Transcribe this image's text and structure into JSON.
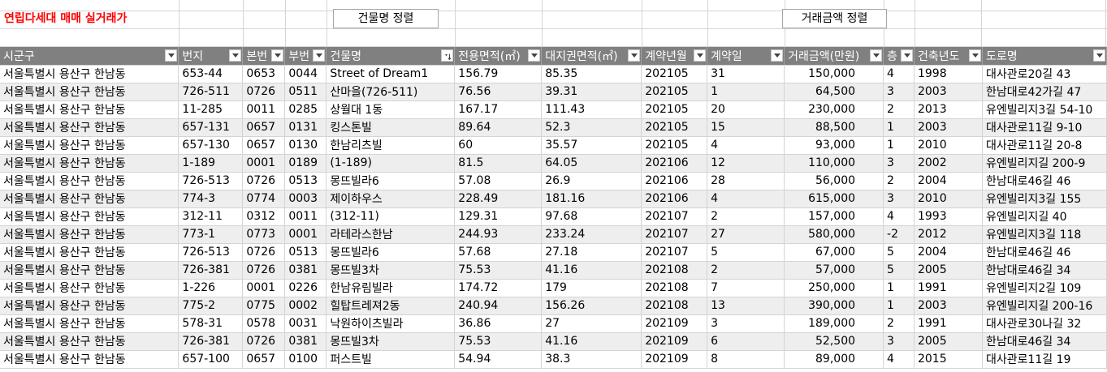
{
  "title": "연립다세대 매매 실거래가",
  "buttons": {
    "sort_by_building": "건물명 정렬",
    "sort_by_price": "거래금액 정렬"
  },
  "columns": [
    {
      "label": "시군구",
      "icon": "dropdown-arrow-icon"
    },
    {
      "label": "번지",
      "icon": "dropdown-arrow-icon"
    },
    {
      "label": "본번",
      "icon": "dropdown-arrow-icon"
    },
    {
      "label": "부번",
      "icon": "dropdown-arrow-icon"
    },
    {
      "label": "건물명",
      "icon": "sort-ascending-filter-icon"
    },
    {
      "label": "전용면적(㎡)",
      "icon": "dropdown-arrow-icon"
    },
    {
      "label": "대지권면적(㎡)",
      "icon": "dropdown-arrow-icon"
    },
    {
      "label": "계약년월",
      "icon": "dropdown-arrow-icon"
    },
    {
      "label": "계약일",
      "icon": "dropdown-arrow-icon"
    },
    {
      "label": "거래금액(만원)",
      "icon": "dropdown-arrow-icon"
    },
    {
      "label": "층",
      "icon": "dropdown-arrow-icon"
    },
    {
      "label": "건축년도",
      "icon": "dropdown-arrow-icon"
    },
    {
      "label": "도로명",
      "icon": "dropdown-arrow-icon"
    }
  ],
  "rows": [
    [
      "서울특별시 용산구 한남동",
      "653-44",
      "0653",
      "0044",
      "Street of Dream1",
      "156.79",
      "85.35",
      "202105",
      "31",
      "150,000",
      "4",
      "1998",
      "대사관로20길 43"
    ],
    [
      "서울특별시 용산구 한남동",
      "726-511",
      "0726",
      "0511",
      "산마을(726-511)",
      "76.56",
      "39.31",
      "202105",
      "1",
      "64,500",
      "3",
      "2003",
      "한남대로42가길 47"
    ],
    [
      "서울특별시 용산구 한남동",
      "11-285",
      "0011",
      "0285",
      "상월대 1동",
      "167.17",
      "111.43",
      "202105",
      "20",
      "230,000",
      "2",
      "2013",
      "유엔빌리지3길 54-10"
    ],
    [
      "서울특별시 용산구 한남동",
      "657-131",
      "0657",
      "0131",
      "킹스톤빌",
      "89.64",
      "52.3",
      "202105",
      "15",
      "88,500",
      "1",
      "2003",
      "대사관로11길 9-10"
    ],
    [
      "서울특별시 용산구 한남동",
      "657-130",
      "0657",
      "0130",
      "한남리츠빌",
      "60",
      "35.57",
      "202105",
      "4",
      "93,000",
      "1",
      "2010",
      "대사관로11길 20-8"
    ],
    [
      "서울특별시 용산구 한남동",
      "1-189",
      "0001",
      "0189",
      "(1-189)",
      "81.5",
      "64.05",
      "202106",
      "12",
      "110,000",
      "3",
      "2002",
      "유엔빌리지길 200-9"
    ],
    [
      "서울특별시 용산구 한남동",
      "726-513",
      "0726",
      "0513",
      "몽뜨빌라6",
      "57.08",
      "26.9",
      "202106",
      "28",
      "56,000",
      "2",
      "2004",
      "한남대로46길 46"
    ],
    [
      "서울특별시 용산구 한남동",
      "774-3",
      "0774",
      "0003",
      "제이하우스",
      "228.49",
      "181.16",
      "202106",
      "4",
      "615,000",
      "3",
      "2010",
      "유엔빌리지3길 155"
    ],
    [
      "서울특별시 용산구 한남동",
      "312-11",
      "0312",
      "0011",
      "(312-11)",
      "129.31",
      "97.68",
      "202107",
      "2",
      "157,000",
      "4",
      "1993",
      "유엔빌리지길 40"
    ],
    [
      "서울특별시 용산구 한남동",
      "773-1",
      "0773",
      "0001",
      "라테라스한남",
      "244.93",
      "233.24",
      "202107",
      "27",
      "580,000",
      "-2",
      "2012",
      "유엔빌리지3길 118"
    ],
    [
      "서울특별시 용산구 한남동",
      "726-513",
      "0726",
      "0513",
      "몽뜨빌라6",
      "57.68",
      "27.18",
      "202107",
      "5",
      "67,000",
      "5",
      "2004",
      "한남대로46길 46"
    ],
    [
      "서울특별시 용산구 한남동",
      "726-381",
      "0726",
      "0381",
      "몽뜨빌3차",
      "75.53",
      "41.16",
      "202108",
      "2",
      "57,000",
      "5",
      "2005",
      "한남대로46길 34"
    ],
    [
      "서울특별시 용산구 한남동",
      "1-226",
      "0001",
      "0226",
      "한남유림빌라",
      "174.72",
      "179",
      "202108",
      "7",
      "250,000",
      "1",
      "1991",
      "유엔빌리지2길 109"
    ],
    [
      "서울특별시 용산구 한남동",
      "775-2",
      "0775",
      "0002",
      "힐탑트레져2동",
      "240.94",
      "156.26",
      "202108",
      "13",
      "390,000",
      "1",
      "2003",
      "유엔빌리지길 200-16"
    ],
    [
      "서울특별시 용산구 한남동",
      "578-31",
      "0578",
      "0031",
      "낙원하이츠빌라",
      "36.86",
      "27",
      "202109",
      "3",
      "189,000",
      "2",
      "1991",
      "대사관로30나길 32"
    ],
    [
      "서울특별시 용산구 한남동",
      "726-381",
      "0726",
      "0381",
      "몽뜨빌3차",
      "75.53",
      "41.16",
      "202109",
      "6",
      "52,500",
      "3",
      "2005",
      "한남대로46길 34"
    ],
    [
      "서울특별시 용산구 한남동",
      "657-100",
      "0657",
      "0100",
      "퍼스트빌",
      "54.94",
      "38.3",
      "202109",
      "8",
      "89,000",
      "4",
      "2015",
      "대사관로11길 19"
    ]
  ],
  "colors": {
    "title": "#ff0000",
    "header_bg": "#808080",
    "alt_row_bg": "#eeeeee"
  }
}
